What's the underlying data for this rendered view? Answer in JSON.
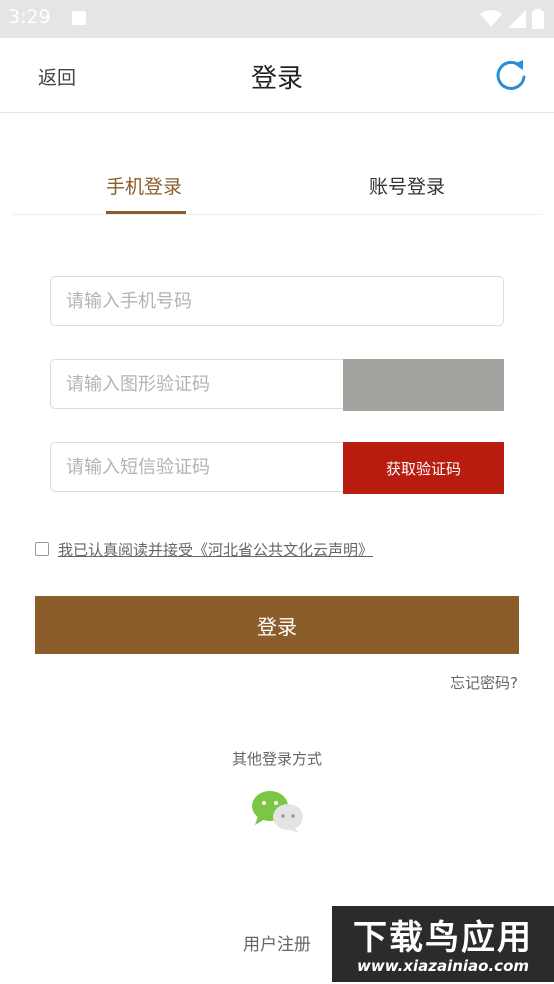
{
  "status_bar": {
    "time": "3:29"
  },
  "nav": {
    "back_label": "返回",
    "title": "登录"
  },
  "tabs": [
    {
      "label": "手机登录",
      "active": true
    },
    {
      "label": "账号登录",
      "active": false
    }
  ],
  "form": {
    "phone_placeholder": "请输入手机号码",
    "captcha_placeholder": "请输入图形验证码",
    "sms_placeholder": "请输入短信验证码",
    "sms_button": "获取验证码"
  },
  "agreement": {
    "text": "我已认真阅读并接受《河北省公共文化云声明》",
    "checked": false
  },
  "login_button": "登录",
  "forgot_password": "忘记密码?",
  "other_login": {
    "title": "其他登录方式",
    "icons": [
      "wechat-icon"
    ]
  },
  "register_label": "用户注册",
  "watermark": {
    "title": "下载鸟应用",
    "url": "www.xiazainiao.com"
  },
  "colors": {
    "accent": "#8a5d2b",
    "sms_button": "#b71c0e",
    "captcha_bg": "#a3a3a0",
    "refresh": "#2a8fd6"
  }
}
